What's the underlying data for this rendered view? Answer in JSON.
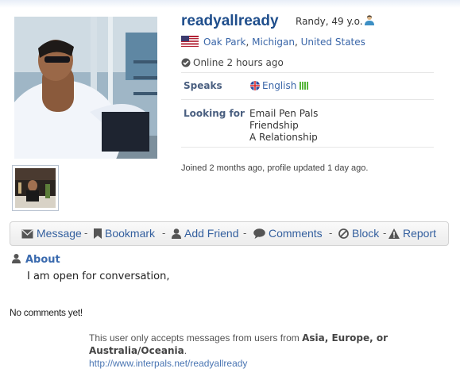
{
  "profile": {
    "username": "readyallready",
    "age_sex": "Randy, 49 y.o.",
    "location": {
      "city": "Oak Park",
      "region": "Michigan",
      "country": "United States",
      "separator": ","
    },
    "online_status": "Online 2 hours ago",
    "speaks": {
      "label": "Speaks",
      "language": "English"
    },
    "looking_for": {
      "label": "Looking for",
      "items": [
        "Email Pen Pals",
        "Friendship",
        "A Relationship"
      ]
    },
    "joined_text": "Joined 2 months ago, profile updated 1 day ago."
  },
  "actions": {
    "message": "Message",
    "bookmark": "Bookmark",
    "add_friend": "Add Friend",
    "comments": "Comments",
    "block": "Block",
    "report": "Report",
    "separator": "-"
  },
  "about": {
    "heading": "About",
    "text": "I am open for conversation,"
  },
  "comments": {
    "empty_text": "No comments yet!"
  },
  "restriction": {
    "prefix": "This user only accepts messages from users from ",
    "regions": "Asia, Europe, or Australia/Oceania",
    "suffix": ".",
    "url": "http://www.interpals.net/readyallready"
  },
  "colors": {
    "link": "#335f9e",
    "username": "#1f4e8c",
    "fluency_green": "#57b53b"
  }
}
